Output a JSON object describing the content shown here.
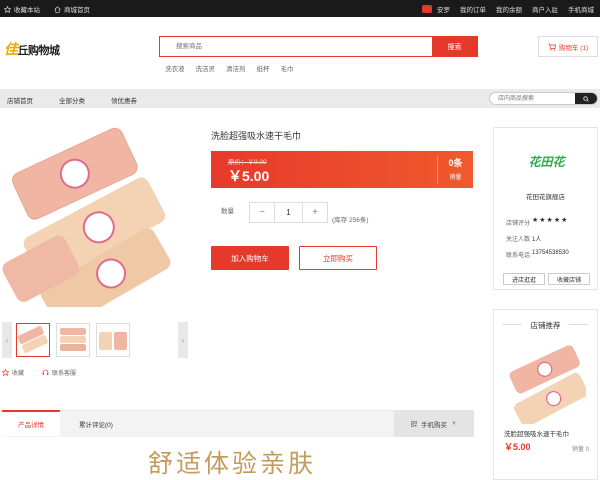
{
  "topbar": {
    "favorite_site": "收藏本站",
    "mall_home": "商城首页",
    "username": "安罗",
    "my_orders": "我的订单",
    "my_balance": "我的余额",
    "merchant_entry": "商户入驻",
    "mobile_mall": "手机商城"
  },
  "header": {
    "logo_text": "佳丘购物城",
    "search_placeholder": "搜索商品",
    "search_button": "搜索",
    "hot_words": [
      "洗衣液",
      "洗洁灵",
      "清洁剂",
      "纸杯",
      "毛巾"
    ],
    "cart_label": "购物车 (1)"
  },
  "nav": {
    "items": [
      "店铺首页",
      "全部分类",
      "领优惠券"
    ],
    "shop_search_placeholder": "店内商品搜索"
  },
  "product": {
    "title": "洗脸超强吸水速干毛巾",
    "original_price": "原价：￥9.00",
    "price": "￥5.00",
    "sold_count": "0条",
    "sold_label": "销量",
    "qty_label": "数量",
    "qty_minus": "−",
    "qty_value": "1",
    "qty_plus": "+",
    "stock": "(库存 256条)",
    "add_to_cart": "加入购物车",
    "buy_now": "立即购买",
    "favorite": "收藏",
    "contact_service": "联系客服"
  },
  "shop": {
    "logo": "花田花",
    "name": "花田花旗舰店",
    "rating_label": "店铺评分",
    "rating_stars": "★★★★★",
    "followers_label": "关注人数",
    "followers": "1人",
    "phone_label": "联系电话",
    "phone": "13754538530",
    "enter_shop": "进店逛逛",
    "follow_shop": "收藏店铺"
  },
  "recommend": {
    "title": "店铺推荐",
    "item_name": "洗脸超强吸水速干毛巾",
    "item_price": "￥5.00",
    "item_sold": "销量 0"
  },
  "tabs": {
    "details": "产品详情",
    "reviews": "累计评论(0)",
    "mobile_buy": "手机购买"
  },
  "detail": {
    "slogan": "舒适体验亲肤"
  },
  "colors": {
    "accent": "#e53a2b",
    "topbar": "#1a1a1a",
    "shop_green": "#2dab4f"
  }
}
